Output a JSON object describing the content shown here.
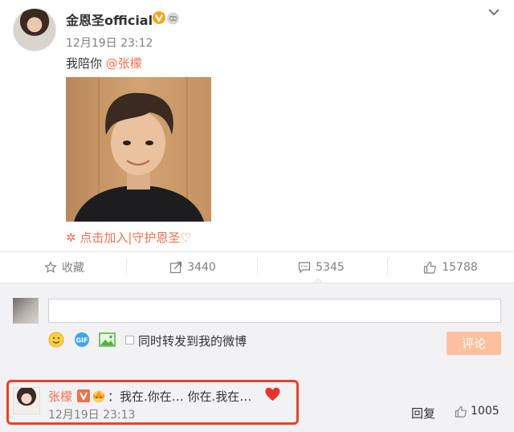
{
  "post": {
    "username": "金恩圣official",
    "timestamp": "12月19日 23:12",
    "text": "我陪你",
    "mention": "@张檬",
    "fan_link": "✲ 点击加入|守护恩圣♡"
  },
  "actions": {
    "favorite_label": "收藏",
    "repost_count": "3440",
    "comment_count": "5345",
    "like_count": "15788"
  },
  "composer": {
    "input_value": "",
    "repost_checkbox_label": "同时转发到我的微博",
    "submit_label": "评论"
  },
  "reply": {
    "name": "张檬",
    "text": "：我在.你在… 你在.我在…",
    "timestamp": "12月19日 23:13",
    "reply_label": "回复",
    "like_count": "1005"
  },
  "icons": {
    "verified": "verified-v-icon",
    "robot": "robot-badge-icon",
    "chevron": "chevron-down-icon",
    "star": "star-icon",
    "share": "share-icon",
    "comment": "comment-icon",
    "like": "thumbs-up-icon",
    "emoji": "emoji-icon",
    "gif": "gif-icon",
    "image": "image-icon",
    "heart": "heart-icon",
    "crown": "crown-badge-icon"
  },
  "colors": {
    "accent": "#eb7350",
    "submit_bg": "#ffc09f",
    "highlight_border": "#e8412c",
    "verified": "#f5a623"
  }
}
